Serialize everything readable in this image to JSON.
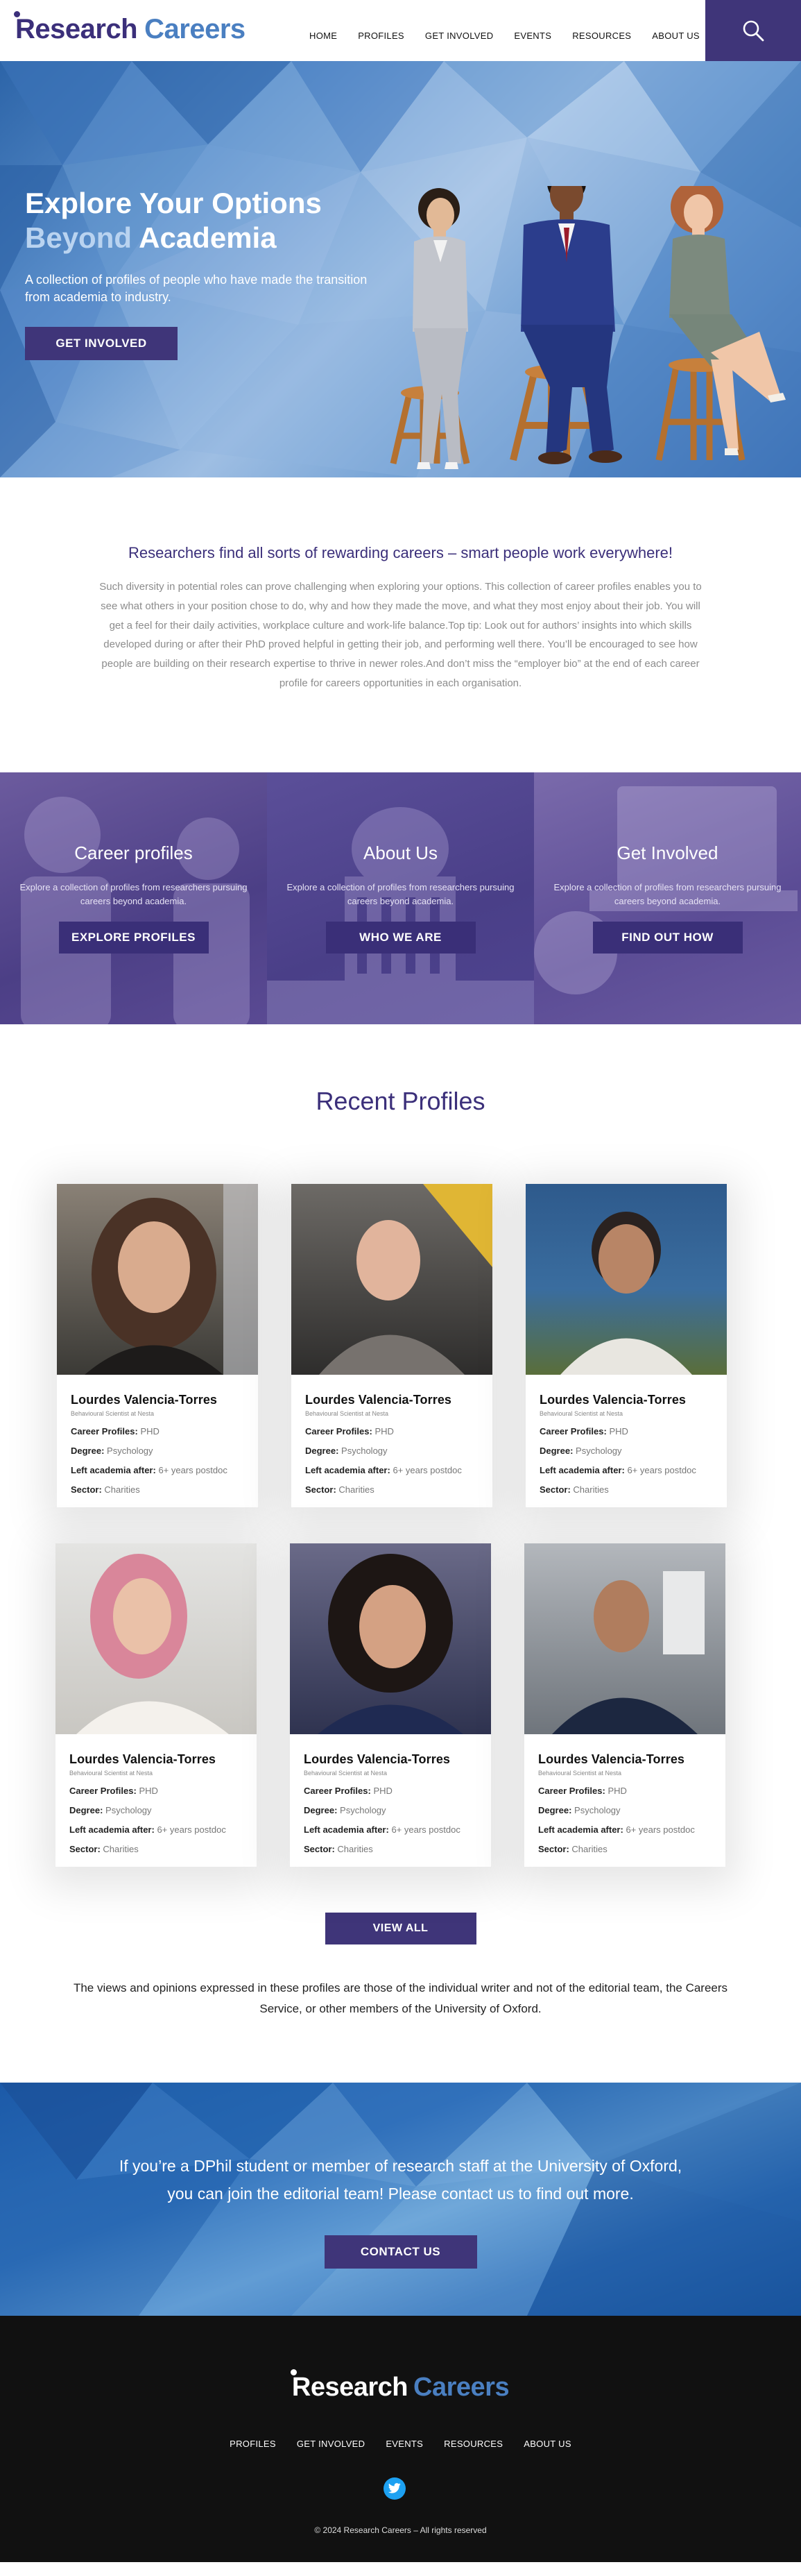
{
  "header": {
    "logo_word1": "Research",
    "logo_word2": "Careers",
    "nav": [
      "HOME",
      "PROFILES",
      "GET INVOLVED",
      "EVENTS",
      "RESOURCES",
      "ABOUT US"
    ],
    "search_icon": "search-icon"
  },
  "hero": {
    "title_line1": "Explore Your Options",
    "title_highlight": "Beyond",
    "title_rest": " Academia",
    "subtitle": "A collection of profiles of people who have made the transition from academia to industry.",
    "button": "GET INVOLVED"
  },
  "intro": {
    "heading": "Researchers find all sorts of rewarding careers – smart people work everywhere!",
    "body": "Such diversity in potential roles can prove challenging when exploring your options. This collection of career profiles enables you to see what others in your position chose to do, why and how they made the move, and what they most enjoy about their job. You will get a feel for their daily activities, workplace culture and work-life balance.Top tip: Look out for authors’ insights into which skills developed during or after their PhD proved helpful in getting their job, and performing well there. You’ll be encouraged to see how people are building on their research expertise to thrive in newer roles.And don’t miss the “employer bio” at the end of each career profile for careers opportunities in each organisation."
  },
  "tiles": [
    {
      "title": "Career profiles",
      "text": "Explore a collection of profiles from researchers pursuing careers beyond academia.",
      "button": "EXPLORE PROFILES"
    },
    {
      "title": "About Us",
      "text": "Explore a collection of profiles from researchers pursuing careers beyond academia.",
      "button": "WHO WE ARE"
    },
    {
      "title": "Get Involved",
      "text": "Explore a collection of profiles from researchers pursuing careers beyond academia.",
      "button": "FIND OUT HOW"
    }
  ],
  "recent": {
    "heading": "Recent Profiles",
    "labels": {
      "career": "Career Profiles:",
      "degree": "Degree:",
      "left": "Left academia after:",
      "sector": "Sector:"
    },
    "profiles": [
      {
        "name": "Lourdes Valencia-Torres",
        "role": "Behavioural Scientist at Nesta",
        "career": "PHD",
        "degree": "Psychology",
        "left": "6+ years postdoc",
        "sector": "Charities"
      },
      {
        "name": "Lourdes Valencia-Torres",
        "role": "Behavioural Scientist at Nesta",
        "career": "PHD",
        "degree": "Psychology",
        "left": "6+ years postdoc",
        "sector": "Charities"
      },
      {
        "name": "Lourdes Valencia-Torres",
        "role": "Behavioural Scientist at Nesta",
        "career": "PHD",
        "degree": "Psychology",
        "left": "6+ years postdoc",
        "sector": "Charities"
      },
      {
        "name": "Lourdes Valencia-Torres",
        "role": "Behavioural Scientist at Nesta",
        "career": "PHD",
        "degree": "Psychology",
        "left": "6+ years postdoc",
        "sector": "Charities"
      },
      {
        "name": "Lourdes Valencia-Torres",
        "role": "Behavioural Scientist at Nesta",
        "career": "PHD",
        "degree": "Psychology",
        "left": "6+ years postdoc",
        "sector": "Charities"
      },
      {
        "name": "Lourdes Valencia-Torres",
        "role": "Behavioural Scientist at Nesta",
        "career": "PHD",
        "degree": "Psychology",
        "left": "6+ years postdoc",
        "sector": "Charities"
      }
    ],
    "view_all": "VIEW ALL",
    "disclaimer": "The views and opinions expressed in these profiles are those of the individual writer and not of the editorial team, the Careers Service, or other members of the University of Oxford."
  },
  "cta": {
    "line1": "If you’re a DPhil student or member of research staff at the University of Oxford,",
    "line2": "you can join the editorial team! Please contact us to find out more.",
    "button": "CONTACT US"
  },
  "footer": {
    "logo_word1": "Research",
    "logo_word2": "Careers",
    "nav": [
      "PROFILES",
      "GET INVOLVED",
      "EVENTS",
      "RESOURCES",
      "ABOUT US"
    ],
    "social_icon": "twitter-icon",
    "copyright": "© 2024 Research Careers – All rights reserved"
  },
  "colors": {
    "brand_purple": "#3f3579",
    "brand_blue": "#4a7fc1",
    "footer_bg": "#111111"
  }
}
